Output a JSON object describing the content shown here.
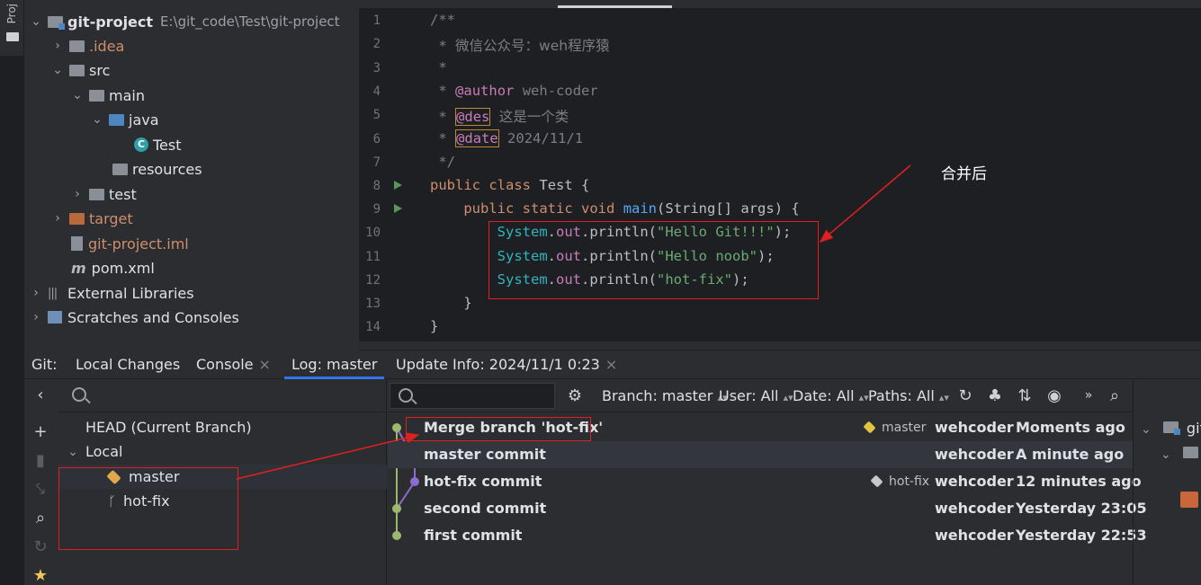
{
  "sidebar": {
    "project_label": "Proj"
  },
  "project": {
    "root_name": "git-project",
    "root_path": "E:\\git_code\\Test\\git-project",
    "items": [
      {
        "label": ".idea"
      },
      {
        "label": "src"
      },
      {
        "label": "main"
      },
      {
        "label": "java"
      },
      {
        "label": "Test"
      },
      {
        "label": "resources"
      },
      {
        "label": "test"
      },
      {
        "label": "target"
      },
      {
        "label": "git-project.iml"
      },
      {
        "label": "pom.xml"
      },
      {
        "label": "External Libraries"
      },
      {
        "label": "Scratches and Consoles"
      }
    ]
  },
  "editor": {
    "line_numbers": [
      "1",
      "2",
      "3",
      "4",
      "5",
      "6",
      "7",
      "8",
      "9",
      "10",
      "11",
      "12",
      "13",
      "14"
    ],
    "comment": {
      "open": "/**",
      "star": "*",
      "wechat": "微信公众号：weh程序猿",
      "author_tag": "@author",
      "author_value": "weh-coder",
      "des_tag": "@des",
      "des_value": "这是一个类",
      "date_tag": "@date",
      "date_value": "2024/11/1",
      "close": "*/"
    },
    "class_decl": {
      "kw1": "public",
      "kw2": "class",
      "name": "Test",
      "brace": "{"
    },
    "method_decl": {
      "kw1": "public",
      "kw2": "static",
      "kw3": "void",
      "name": "main",
      "params_open": "(",
      "param_type": "String[]",
      "param_name": "args",
      "params_close": ")",
      "brace": "{"
    },
    "prints": [
      {
        "sys": "System",
        "dot1": ".",
        "out": "out",
        "dot2": ".",
        "fn": "println",
        "open": "(",
        "str": "\"Hello Git!!!\"",
        "close": ");"
      },
      {
        "sys": "System",
        "dot1": ".",
        "out": "out",
        "dot2": ".",
        "fn": "println",
        "open": "(",
        "str": "\"Hello noob\"",
        "close": ");"
      },
      {
        "sys": "System",
        "dot1": ".",
        "out": "out",
        "dot2": ".",
        "fn": "println",
        "open": "(",
        "str": "\"hot-fix\"",
        "close": ");"
      }
    ],
    "close_method": "}",
    "close_class": "}",
    "annotation_label": "合并后"
  },
  "git": {
    "tabs": [
      {
        "label": "Git:"
      },
      {
        "label": "Local Changes"
      },
      {
        "label": "Console"
      },
      {
        "label": "Log: master"
      },
      {
        "label": "Update Info: 2024/11/1 0:23"
      }
    ],
    "close_glyph": "×",
    "branches": {
      "head": "HEAD (Current Branch)",
      "local": "Local",
      "items": [
        {
          "label": "master"
        },
        {
          "label": "hot-fix"
        }
      ]
    },
    "filters": {
      "branch": "Branch: master",
      "user": "User: All",
      "date": "Date: All",
      "paths": "Paths: All",
      "arrow": "▴▾"
    },
    "commits": [
      {
        "message": "Merge branch 'hot-fix'",
        "ref": "master",
        "author": "wehcoder",
        "date": "Moments ago"
      },
      {
        "message": "master commit",
        "ref": "",
        "author": "wehcoder",
        "date": "A minute ago"
      },
      {
        "message": "hot-fix commit",
        "ref": "hot-fix",
        "author": "wehcoder",
        "date": "12 minutes ago"
      },
      {
        "message": "second commit",
        "ref": "",
        "author": "wehcoder",
        "date": "Yesterday 23:05"
      },
      {
        "message": "first commit",
        "ref": "",
        "author": "wehcoder",
        "date": "Yesterday 22:53"
      }
    ],
    "right_pane": {
      "root_label": "git"
    }
  },
  "colors": {
    "graph_green": "#9cb86d",
    "graph_purple": "#8d6ccf",
    "annotation_red": "#e02020",
    "ref_tag_yellow": "#e0c340",
    "ref_tag_gray": "#c6c8cc"
  }
}
